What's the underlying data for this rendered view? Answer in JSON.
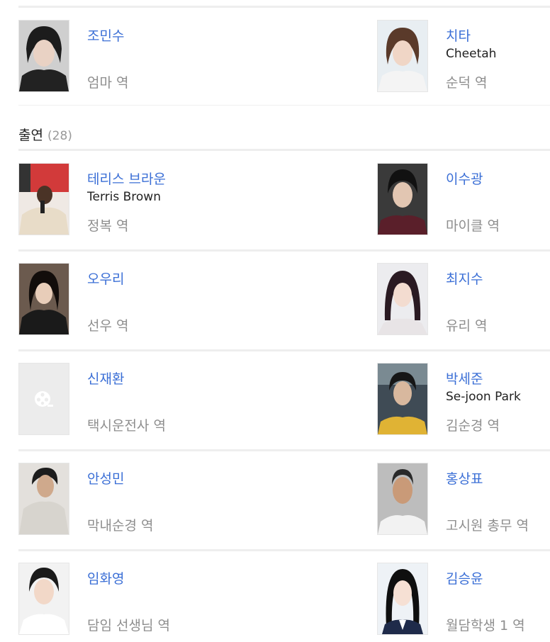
{
  "top_row": [
    {
      "name": "조민수",
      "eng": "",
      "role": "엄마 역",
      "photo": "photo-cho-minsu"
    },
    {
      "name": "치타",
      "eng": "Cheetah",
      "role": "순덕 역",
      "photo": "photo-cheetah"
    }
  ],
  "cast_section": {
    "label": "출연",
    "count": "(28)"
  },
  "cast": [
    [
      {
        "name": "테리스 브라운",
        "eng": "Terris Brown",
        "role": "정복 역",
        "photo": "photo-terris-brown"
      },
      {
        "name": "이수광",
        "eng": "",
        "role": "마이클 역",
        "photo": "photo-lee-sukwang"
      }
    ],
    [
      {
        "name": "오우리",
        "eng": "",
        "role": "선우 역",
        "photo": "photo-o-uri"
      },
      {
        "name": "최지수",
        "eng": "",
        "role": "유리 역",
        "photo": "photo-choi-jisu"
      }
    ],
    [
      {
        "name": "신재환",
        "eng": "",
        "role": "택시운전사 역",
        "photo": "placeholder-film-reel-icon"
      },
      {
        "name": "박세준",
        "eng": "Se-joon Park",
        "role": "김순경 역",
        "photo": "photo-park-sejun"
      }
    ],
    [
      {
        "name": "안성민",
        "eng": "",
        "role": "막내순경 역",
        "photo": "photo-ahn-seongmin"
      },
      {
        "name": "홍상표",
        "eng": "",
        "role": "고시원 총무 역",
        "photo": "photo-hong-sangpyo"
      }
    ],
    [
      {
        "name": "임화영",
        "eng": "",
        "role": "담임 선생님 역",
        "photo": "photo-im-hwayoung"
      },
      {
        "name": "김승윤",
        "eng": "",
        "role": "월담학생 1 역",
        "photo": "photo-kim-seungyun"
      }
    ]
  ]
}
